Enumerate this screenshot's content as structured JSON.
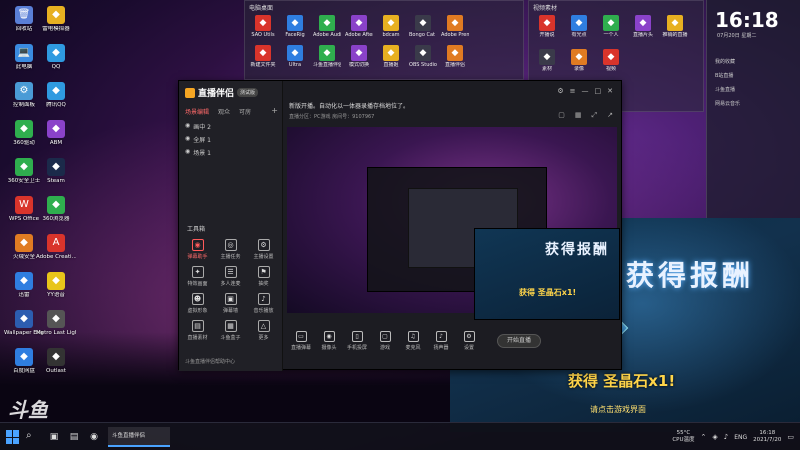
{
  "desktop": {
    "icons": [
      {
        "label": "回收站",
        "glyph": "🗑",
        "color": "#5a7fd6"
      },
      {
        "label": "此电脑",
        "glyph": "💻",
        "color": "#3a8be0"
      },
      {
        "label": "控制面板",
        "glyph": "⚙",
        "color": "#4a9bd6"
      },
      {
        "label": "360驱动",
        "glyph": "◆",
        "color": "#2fae4e"
      },
      {
        "label": "360安全卫士",
        "glyph": "◆",
        "color": "#2fae4e"
      },
      {
        "label": "WPS Office",
        "glyph": "W",
        "color": "#d9342b"
      },
      {
        "label": "火绒安全",
        "glyph": "◆",
        "color": "#e07b22"
      },
      {
        "label": "迅雷",
        "glyph": "◆",
        "color": "#2f7ee0"
      },
      {
        "label": "Wallpaper Engine",
        "glyph": "◆",
        "color": "#2c5db0"
      },
      {
        "label": "百度网盘",
        "glyph": "◆",
        "color": "#2f7ee0"
      }
    ],
    "icons_col2": [
      {
        "label": "雷电模拟器",
        "glyph": "◆",
        "color": "#e7b021"
      },
      {
        "label": "QQ",
        "glyph": "◆",
        "color": "#2f9ae0"
      },
      {
        "label": "腾讯QQ",
        "glyph": "◆",
        "color": "#2f9ae0"
      },
      {
        "label": "ABM",
        "glyph": "◆",
        "color": "#8a42c9"
      },
      {
        "label": "Steam",
        "glyph": "◆",
        "color": "#1b2a4a"
      },
      {
        "label": "360浏览器",
        "glyph": "◆",
        "color": "#2fae4e"
      },
      {
        "label": "Adobe Creati...",
        "glyph": "A",
        "color": "#d9342b"
      },
      {
        "label": "YY语音",
        "glyph": "◆",
        "color": "#e8c51a"
      },
      {
        "label": "Metro Last Light Redux",
        "glyph": "◆",
        "color": "#555"
      },
      {
        "label": "Outlast",
        "glyph": "◆",
        "color": "#333"
      }
    ]
  },
  "folders": [
    {
      "title": "电脑桌面",
      "items": [
        "SAO Utils",
        "FaceRig",
        "Adobe Audition CC",
        "Adobe After Effects CC",
        "bdcam",
        "Bongo Cat Mver",
        "Adobe Premiere",
        "新建文件夹",
        "Ultra",
        "斗鱼直播伴侣",
        "模式切换",
        "直播姬",
        "OBS Studio",
        "直播伴侣"
      ]
    },
    {
      "title": "视频素材",
      "items": [
        "开播说",
        "有光点",
        "一个人",
        "直播片头",
        "推销的直播",
        "素材",
        "录像",
        "视频"
      ]
    }
  ],
  "app": {
    "name": "直播伴侣",
    "badge": "测试版",
    "tabs": [
      "场景编辑",
      "观众",
      "可房"
    ],
    "scenes": [
      "画中 2",
      "全屏 1",
      "场景 1"
    ],
    "tools_title": "工具箱",
    "tools": [
      {
        "label": "弹幕助手",
        "glyph": "◉",
        "hot": true
      },
      {
        "label": "主播任务",
        "glyph": "◎",
        "hot": false
      },
      {
        "label": "主播设置",
        "glyph": "⚙",
        "hot": false
      },
      {
        "label": "特效画面",
        "glyph": "✦",
        "hot": false
      },
      {
        "label": "多人连麦",
        "glyph": "☰",
        "hot": false
      },
      {
        "label": "抽奖",
        "glyph": "⚑",
        "hot": false
      },
      {
        "label": "虚拟形象",
        "glyph": "☻",
        "hot": false
      },
      {
        "label": "弹幕墙",
        "glyph": "▣",
        "hot": false
      },
      {
        "label": "音乐播放",
        "glyph": "♪",
        "hot": false
      },
      {
        "label": "直播素材",
        "glyph": "▤",
        "hot": false
      },
      {
        "label": "斗鱼盒子",
        "glyph": "▦",
        "hot": false
      },
      {
        "label": "更多",
        "glyph": "△",
        "hot": false
      }
    ],
    "footer": "斗鱼直播伴侣帮助中心",
    "headline": "新版开播。自动化以一体器录播存档地位了。",
    "stats": "直播分区：PC游戏  房间号：9107967",
    "bottom": [
      {
        "label": "直播弹幕",
        "glyph": "▭"
      },
      {
        "label": "摄像头",
        "glyph": "◉"
      },
      {
        "label": "手机投屏",
        "glyph": "▯"
      },
      {
        "label": "游戏",
        "glyph": "▢"
      },
      {
        "label": "麦克风",
        "glyph": "♫"
      },
      {
        "label": "扬声器",
        "glyph": "♪"
      },
      {
        "label": "设置",
        "glyph": "⚙"
      }
    ],
    "start_label": "开始直播"
  },
  "game": {
    "title": "获得报酬",
    "reward": "获得 圣晶石x1!",
    "hint": "请点击游戏界面"
  },
  "mini_game": {
    "title": "获得报酬",
    "reward": "获得 圣晶石x1!"
  },
  "widgets": {
    "clock": "16:18",
    "date": "07月20日 星期二",
    "rows": [
      "我的收藏",
      "B站直播",
      "斗鱼直播",
      "网易云音乐"
    ]
  },
  "watermark": "斗鱼",
  "taskbar": {
    "app_label": "斗鱼直播伴侣",
    "temp": "55°C",
    "temp_sub": "CPU温度",
    "lang": "ENG",
    "time": "16:18",
    "date": "2021/7/20"
  },
  "colors": {
    "accent": "#4aa3ff",
    "hot": "#ff5a5a",
    "reward": "#ffd54a"
  }
}
